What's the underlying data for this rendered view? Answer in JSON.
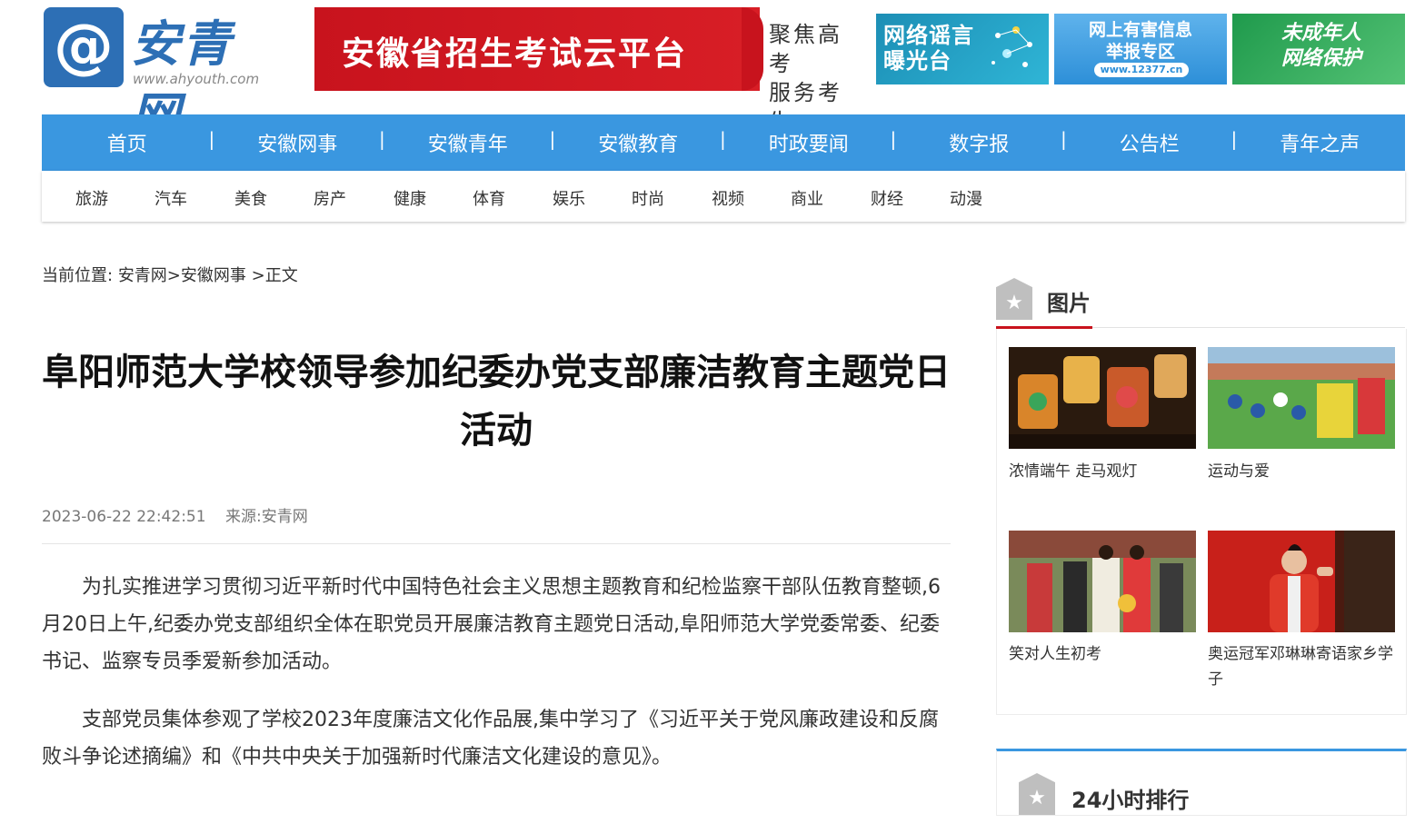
{
  "header": {
    "logo_symbol": "@",
    "logo_name": "安青网",
    "logo_url": "www.ahyouth.com",
    "banner_title": "安徽省招生考试云平台",
    "banner_side_1": "聚焦高考",
    "banner_side_2": "服务考生",
    "ads": [
      {
        "line1": "网络谣言",
        "line2": "曝光台"
      },
      {
        "line1": "网上有害信息",
        "line2": "举报专区",
        "url": "www.12377.cn"
      },
      {
        "line1": "未成年人",
        "line2": "网络保护"
      }
    ]
  },
  "nav": {
    "items": [
      "首页",
      "安徽网事",
      "安徽青年",
      "安徽教育",
      "时政要闻",
      "数字报",
      "公告栏",
      "青年之声"
    ],
    "sub_items": [
      "旅游",
      "汽车",
      "美食",
      "房产",
      "健康",
      "体育",
      "娱乐",
      "时尚",
      "视频",
      "商业",
      "财经",
      "动漫"
    ]
  },
  "breadcrumb": {
    "prefix": "当前位置:",
    "path": "安青网>安徽网事 >正文"
  },
  "article": {
    "title": "阜阳师范大学校领导参加纪委办党支部廉洁教育主题党日活动",
    "date": "2023-06-22 22:42:51",
    "source": "来源:安青网",
    "paragraphs": [
      "为扎实推进学习贯彻习近平新时代中国特色社会主义思想主题教育和纪检监察干部队伍教育整顿,6月20日上午,纪委办党支部组织全体在职党员开展廉洁教育主题党日活动,阜阳师范大学党委常委、纪委书记、监察专员季爱新参加活动。",
      "支部党员集体参观了学校2023年度廉洁文化作品展,集中学习了《习近平关于党风廉政建设和反腐败斗争论述摘编》和《中共中央关于加强新时代廉洁文化建设的意见》。"
    ]
  },
  "sidebar": {
    "pictures_title": "图片",
    "badge_icon": "★",
    "pictures": [
      {
        "caption": "浓情端午 走马观灯"
      },
      {
        "caption": "运动与爱"
      },
      {
        "caption": "笑对人生初考"
      },
      {
        "caption": "奥运冠军邓琳琳寄语家乡学子"
      }
    ],
    "ranking_title": "24小时排行"
  },
  "colors": {
    "nav_blue": "#3a97e0",
    "logo_blue": "#2d6fb5",
    "banner_red": "#c8131d"
  }
}
